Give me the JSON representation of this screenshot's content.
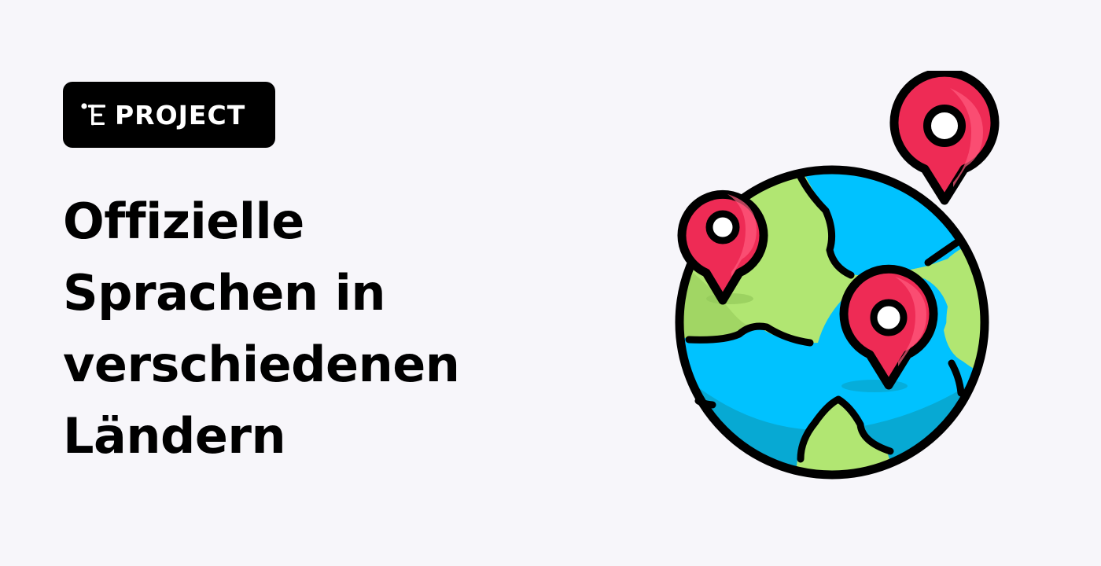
{
  "badge": {
    "label": "PROJECT",
    "logo_icon": "labex-logo-icon",
    "background_color": "#000000",
    "text_color": "#ffffff"
  },
  "headline": {
    "lines": [
      "Offizielle",
      "Sprachen in",
      "verschiedenen",
      "Ländern"
    ]
  },
  "illustration": {
    "icon": "globe-with-location-pins-icon",
    "colors": {
      "ocean": "#00c2ff",
      "ocean_shade": "#07a9d3",
      "land": "#b1e672",
      "land_shade": "#93c95a",
      "pin": "#ee2b55",
      "pin_highlight": "#ff5c7f",
      "outline": "#000000"
    }
  },
  "page": {
    "background_color": "#f7f6fa"
  }
}
